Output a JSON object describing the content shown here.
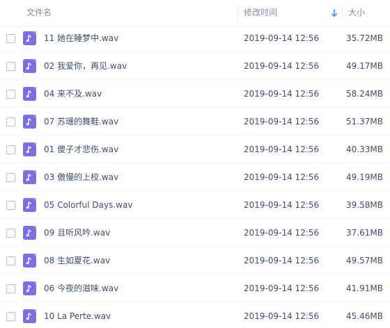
{
  "header": {
    "name_label": "文件名",
    "modified_label": "修改时间",
    "size_label": "大小",
    "sort_icon": "arrow-down-icon"
  },
  "colors": {
    "icon_purple": "#7b6fe6",
    "text": "#424e67",
    "header_text": "#878c9c",
    "sort_arrow": "#3b8cff"
  },
  "files": [
    {
      "name": "11 她在睡梦中.wav",
      "modified": "2019-09-14 12:56",
      "size": "35.72MB",
      "icon": "music-file-icon"
    },
    {
      "name": "02 我爱你，再见.wav",
      "modified": "2019-09-14 12:56",
      "size": "49.17MB",
      "icon": "music-file-icon"
    },
    {
      "name": "04 来不及.wav",
      "modified": "2019-09-14 12:56",
      "size": "58.24MB",
      "icon": "music-file-icon"
    },
    {
      "name": "07 苏珊的舞鞋.wav",
      "modified": "2019-09-14 12:56",
      "size": "51.37MB",
      "icon": "music-file-icon"
    },
    {
      "name": "01 傻子才悲伤.wav",
      "modified": "2019-09-14 12:56",
      "size": "40.33MB",
      "icon": "music-file-icon"
    },
    {
      "name": "03 傲慢的上校.wav",
      "modified": "2019-09-14 12:56",
      "size": "49.19MB",
      "icon": "music-file-icon"
    },
    {
      "name": "05 Colorful Days.wav",
      "modified": "2019-09-14 12:56",
      "size": "39.58MB",
      "icon": "music-file-icon"
    },
    {
      "name": "09 且听风吟.wav",
      "modified": "2019-09-14 12:56",
      "size": "37.61MB",
      "icon": "music-file-icon"
    },
    {
      "name": "08 生如夏花.wav",
      "modified": "2019-09-14 12:56",
      "size": "49.57MB",
      "icon": "music-file-icon"
    },
    {
      "name": "06 今夜的滋味.wav",
      "modified": "2019-09-14 12:56",
      "size": "41.91MB",
      "icon": "music-file-icon"
    },
    {
      "name": "10 La Perte.wav",
      "modified": "2019-09-14 12:56",
      "size": "45.46MB",
      "icon": "music-file-icon"
    }
  ]
}
